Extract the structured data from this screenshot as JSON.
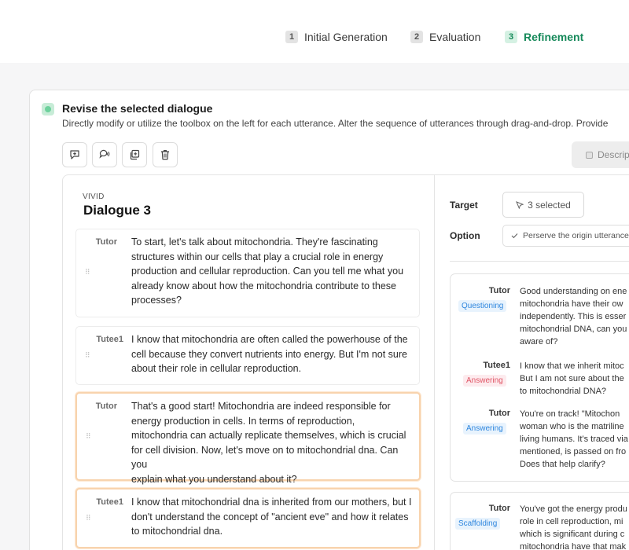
{
  "steps": [
    {
      "num": "1",
      "label": "Initial Generation"
    },
    {
      "num": "2",
      "label": "Evaluation"
    },
    {
      "num": "3",
      "label": "Refinement"
    }
  ],
  "card": {
    "title": "Revise the selected dialogue",
    "subtitle": "Directly modify or utilize the toolbox on the left for each utterance. Alter the sequence of utterances through drag-and-drop. Provide",
    "description_button": "Descript"
  },
  "toolbar": {
    "icons": [
      "add-utterance-icon",
      "speech-icon",
      "duplicate-icon",
      "trash-icon"
    ]
  },
  "dialogue": {
    "source": "VIVID",
    "title": "Dialogue 3",
    "utterances": [
      {
        "speaker": "Tutor",
        "lines": [
          "To start, let's talk about mitochondria. They're fascinating",
          "structures within our cells that play a crucial role in energy",
          "production and cellular reproduction. Can you tell me what you",
          "already know about how the mitochondria contribute to these",
          "processes?"
        ],
        "selected": false
      },
      {
        "speaker": "Tutee1",
        "lines": [
          "I know that mitochondria are often called the powerhouse of the",
          "cell because they convert nutrients into energy. But I'm not sure",
          "about their role in cellular reproduction."
        ],
        "selected": false
      },
      {
        "speaker": "Tutor",
        "lines": [
          "That's a good start! Mitochondria are indeed responsible for",
          "energy production in cells. In terms of reproduction,",
          "mitochondria can actually replicate themselves, which is crucial",
          "for cell division. Now, let's move on to mitochondrial dna. Can you",
          "explain what you understand about it?"
        ],
        "selected": true
      },
      {
        "speaker": "Tutee1",
        "lines": [
          "I know that mitochondrial dna is inherited from our mothers, but I",
          "don't understand the concept of \"ancient eve\" and how it relates",
          "to mitochondrial dna."
        ],
        "selected": true
      }
    ]
  },
  "refine": {
    "target_label": "Target",
    "target_value": "3 selected",
    "option_label": "Option",
    "option_value": "Perserve the origin utterance",
    "cards": [
      {
        "turns": [
          {
            "speaker": "Tutor",
            "tag": "Questioning",
            "tag_color": "blue",
            "lines": [
              "Good understanding on ene",
              "mitochondria have their ow",
              "independently. This is esser",
              "mitochondrial DNA, can you",
              "aware of?"
            ]
          },
          {
            "speaker": "Tutee1",
            "tag": "Answering",
            "tag_color": "red",
            "lines": [
              "I know that we inherit mitoc",
              "But I am not sure about the",
              "to mitochondrial DNA?"
            ]
          },
          {
            "speaker": "Tutor",
            "tag": "Answering",
            "tag_color": "blue",
            "lines": [
              "You're on track! \"Mitochon",
              "woman who is the matriline",
              "living humans. It's traced via",
              "mentioned, is passed on fro",
              "Does that help clarify?"
            ]
          }
        ]
      },
      {
        "turns": [
          {
            "speaker": "Tutor",
            "tag": "Scaffolding",
            "tag_color": "blue",
            "lines": [
              "You've got the energy produ",
              "role in cell reproduction, mi",
              "which is significant during c",
              "mitochondria have that mak"
            ]
          }
        ]
      }
    ]
  }
}
